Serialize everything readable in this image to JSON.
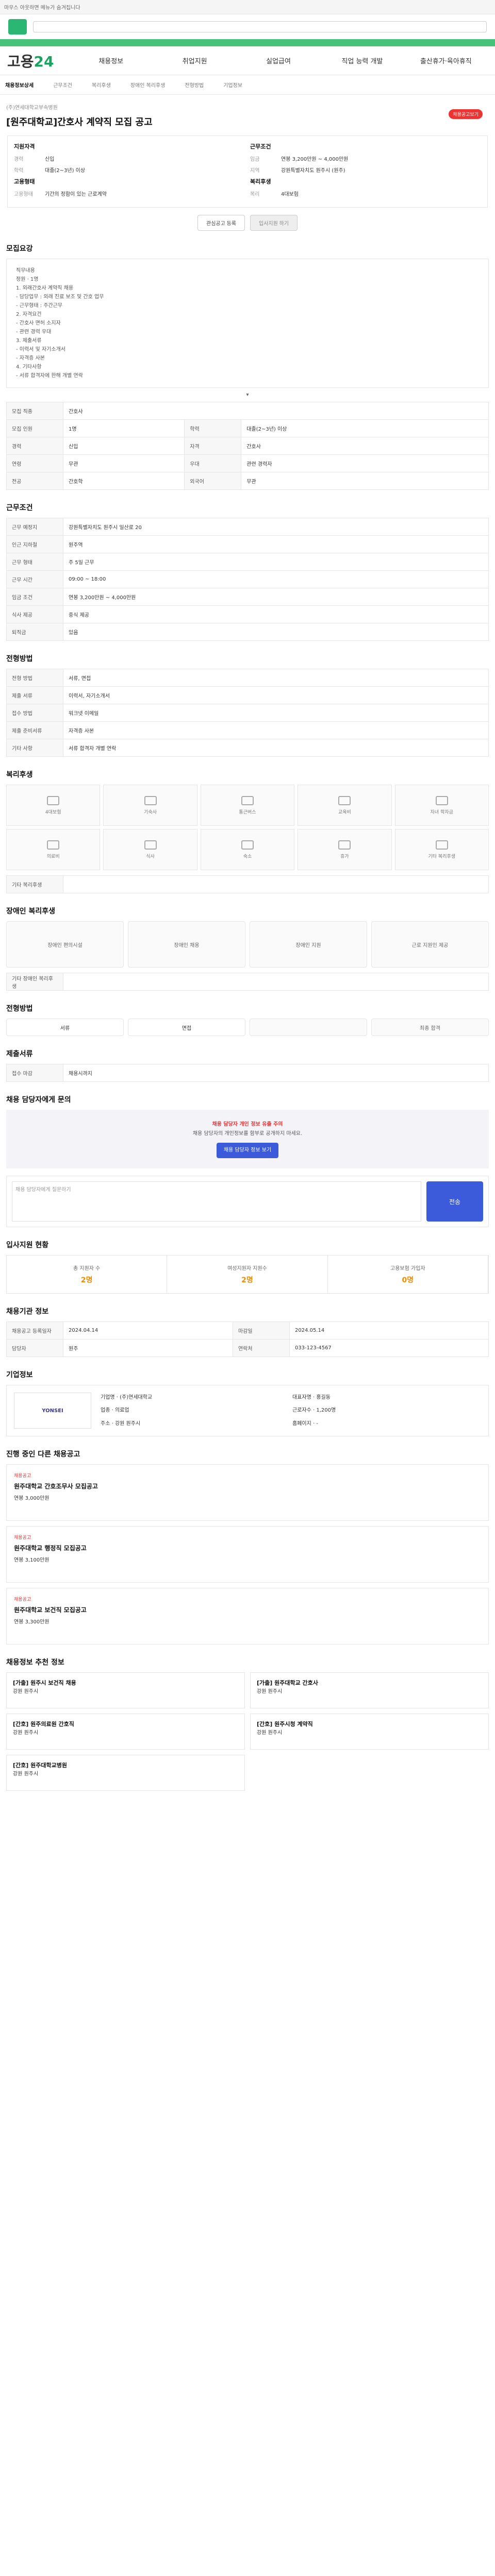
{
  "topbar": {
    "note": "마우스 아웃하면 메뉴가 숨겨집니다"
  },
  "nav": {
    "logo_a": "고용",
    "logo_b": "24",
    "items": [
      "채용정보",
      "취업지원",
      "실업급여",
      "직업 능력 개발",
      "출산휴가·육아휴직"
    ]
  },
  "cats": [
    "채용정보상세",
    "근무조건",
    "복리후생",
    "장애인 복리후생",
    "전형방법",
    "기업정보"
  ],
  "title": {
    "company": "(주)연세대학교부속병원",
    "headline": "[원주대학교]간호사 계약직 모집 공고",
    "badge": "채용공고보기"
  },
  "summary": {
    "left_title": "지원자격",
    "left_rows": [
      {
        "k": "경력",
        "v": "신입"
      },
      {
        "k": "학력",
        "v": "대졸(2~3년) 이상"
      }
    ],
    "right_title": "근무조건",
    "right_rows": [
      {
        "k": "임금",
        "v": "연봉 3,200만원 ~ 4,000만원"
      },
      {
        "k": "지역",
        "v": "강원특별자치도 원주시 (원주)"
      }
    ],
    "left_title2": "고용형태",
    "left_rows2": [
      {
        "k": "고용형태",
        "v": "기간의 정함이 있는 근로계약"
      }
    ],
    "right_title2": "복리후생",
    "right_rows2": [
      {
        "k": "복리",
        "v": "4대보험"
      }
    ]
  },
  "buttons": {
    "scrap": "관심공고 등록",
    "apply": "입사지원 하기"
  },
  "s_req": {
    "heading": "모집요강",
    "box": "직무내용\n정원 · 1명\n1. 외래간호사 계약직 채용\n- 담당업무 : 외래 진료 보조 및 간호 업무\n- 근무형태 : 주간근무\n2. 자격요건\n- 간호사 면허 소지자\n- 관련 경력 우대\n3. 제출서류\n- 이력서 및 자기소개서\n- 자격증 사본\n4. 기타사항\n- 서류 합격자에 한해 개별 연락"
  },
  "req_table": [
    {
      "k": "모집 직종",
      "v": "간호사",
      "k2": "",
      "v2": ""
    },
    {
      "k": "모집 인원",
      "v": "1명",
      "k2": "학력",
      "v2": "대졸(2~3년) 이상"
    },
    {
      "k": "경력",
      "v": "신입",
      "k2": "자격",
      "v2": "간호사"
    },
    {
      "k": "연령",
      "v": "무관",
      "k2": "우대",
      "v2": "관련 경력자"
    },
    {
      "k": "전공",
      "v": "간호학",
      "k2": "외국어",
      "v2": "무관"
    }
  ],
  "s_work": {
    "heading": "근무조건"
  },
  "work_table": [
    {
      "k": "근무 예정지",
      "v": "강원특별자치도 원주시 일산로 20"
    },
    {
      "k": "인근 지하철",
      "v": "원주역"
    },
    {
      "k": "근무 형태",
      "v": "주 5일 근무"
    },
    {
      "k": "근무 시간",
      "v": "09:00 ~ 18:00"
    },
    {
      "k": "임금 조건",
      "v": "연봉 3,200만원 ~ 4,000만원"
    },
    {
      "k": "식사 제공",
      "v": "중식 제공"
    },
    {
      "k": "퇴직금",
      "v": "있음"
    }
  ],
  "s_apply": {
    "heading": "전형방법"
  },
  "apply_table": [
    {
      "k": "전형 방법",
      "v": "서류, 면접"
    },
    {
      "k": "제출 서류",
      "v": "이력서, 자기소개서"
    },
    {
      "k": "접수 방법",
      "v": "워크넷 이메일"
    },
    {
      "k": "제출 준비서류",
      "v": "자격증 사본"
    },
    {
      "k": "기타 사항",
      "v": "서류 합격자 개별 연락"
    }
  ],
  "s_welfare": {
    "heading": "복리후생",
    "items": [
      "4대보험",
      "기숙사",
      "통근버스",
      "교육비",
      "자녀 학자금",
      "의료비",
      "식사",
      "숙소",
      "휴가",
      "기타 복리후생"
    ],
    "more": "기타 복리후생"
  },
  "s_dis": {
    "heading": "장애인 복리후생",
    "items": [
      "장애인 편의시설",
      "장애인 채용",
      "장애인 지원",
      "근로 지원인 제공"
    ],
    "more": "기타 장애인 복리후생"
  },
  "s_proc": {
    "heading": "전형방법",
    "chips": [
      "서류",
      "면접",
      "",
      "최종 합격"
    ]
  },
  "s_doc": {
    "heading": "제출서류",
    "k": "접수 마감",
    "v": "채용시까지"
  },
  "s_qna": {
    "heading": "채용 담당자에게 문의",
    "warn_red": "채용 담당자 개인 정보 유출 주의",
    "warn": "채용 담당자의 개인정보를 함부로 공개하지 마세요.",
    "blue": "채용 담당자 정보 보기",
    "placeholder": "채용 담당자에게 질문하기",
    "send": "전송"
  },
  "s_stat": {
    "heading": "입사지원 현황",
    "items": [
      {
        "k": "총 지원자 수",
        "v": "2명"
      },
      {
        "k": "여성지원자 지원수",
        "v": "2명"
      },
      {
        "k": "고용보험 가입자",
        "v": "0명"
      }
    ]
  },
  "s_info": {
    "heading": "채용기관 정보",
    "rows": [
      {
        "k": "채용공고 등록일자",
        "v": "2024.04.14",
        "k2": "마감일",
        "v2": "2024.05.14"
      },
      {
        "k": "담당자",
        "v": "원주",
        "k2": "연락처",
        "v2": "033-123-4567"
      }
    ]
  },
  "s_company": {
    "heading": "기업정보",
    "logo": "YONSEI",
    "rows": [
      {
        "k": "기업명",
        "v": "(주)연세대학교"
      },
      {
        "k": "대표자명",
        "v": "홍길동"
      },
      {
        "k": "업종",
        "v": "의료업"
      },
      {
        "k": "근로자수",
        "v": "1,200명"
      },
      {
        "k": "주소",
        "v": "강원 원주시"
      },
      {
        "k": "홈페이지",
        "v": "-"
      }
    ]
  },
  "s_jobs": {
    "heading": "진행 중인 다른 채용공고",
    "jobs": [
      {
        "hot": "채용공고",
        "title": "원주대학교 간호조무사 모집공고",
        "d": "연봉 3,000만원"
      },
      {
        "hot": "채용공고",
        "title": "원주대학교 행정직 모집공고",
        "d": "연봉 3,100만원"
      },
      {
        "hot": "채용공고",
        "title": "원주대학교 보건직 모집공고",
        "d": "연봉 3,300만원"
      }
    ]
  },
  "s_recs": {
    "heading": "채용정보 추천 정보",
    "recs": [
      {
        "t": "[가출] 원주시 보건직 채용",
        "s": "강원 원주시"
      },
      {
        "t": "[가출] 원주대학교 간호사",
        "s": "강원 원주시"
      },
      {
        "t": "[간호] 원주의료원 간호직",
        "s": "강원 원주시"
      },
      {
        "t": "[간호] 원주시청 계약직",
        "s": "강원 원주시"
      },
      {
        "t": "[간호] 원주대학교병원",
        "s": "강원 원주시"
      }
    ]
  }
}
